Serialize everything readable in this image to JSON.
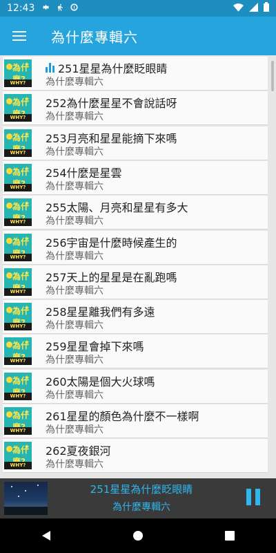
{
  "status_bar": {
    "time": "12:43",
    "icons": [
      "gear-icon",
      "running-icon",
      "data-saver-icon",
      "wifi-icon",
      "battery-icon"
    ]
  },
  "app_bar": {
    "title": "為什麼專輯六",
    "menu_icon": "hamburger-menu-icon",
    "color": "#26a4dd"
  },
  "list": {
    "items": [
      {
        "title": "251星星為什麼眨眼睛",
        "subtitle": "為什麼專輯六",
        "playing": true
      },
      {
        "title": "252為什麼星星不會說話呀",
        "subtitle": "為什麼專輯六"
      },
      {
        "title": "253月亮和星星能摘下來嗎",
        "subtitle": "為什麼專輯六"
      },
      {
        "title": "254什麼是星雲",
        "subtitle": "為什麼專輯六"
      },
      {
        "title": "255太陽、月亮和星星有多大",
        "subtitle": "為什麼專輯六"
      },
      {
        "title": "256宇宙是什麼時候產生的",
        "subtitle": "為什麼專輯六"
      },
      {
        "title": "257天上的星星是在亂跑嗎",
        "subtitle": "為什麼專輯六"
      },
      {
        "title": "258星星離我們有多遠",
        "subtitle": "為什麼專輯六"
      },
      {
        "title": "259星星會掉下來嗎",
        "subtitle": "為什麼專輯六"
      },
      {
        "title": "260太陽是個大火球嗎",
        "subtitle": "為什麼專輯六"
      },
      {
        "title": "261星星的顏色為什麼不一樣啊",
        "subtitle": "為什麼專輯六"
      },
      {
        "title": "262夏夜銀河",
        "subtitle": "為什麼專輯六"
      }
    ],
    "thumb_text": "WHY?",
    "thumb_question": "為什麼?"
  },
  "player": {
    "title": "251星星為什麼眨眼睛",
    "album": "為什麼專輯六",
    "pause_icon": "pause-icon",
    "accent": "#2fb6ee"
  },
  "nav": {
    "back_icon": "back-triangle-icon",
    "home_icon": "home-circle-icon",
    "recents_icon": "recents-square-icon"
  }
}
